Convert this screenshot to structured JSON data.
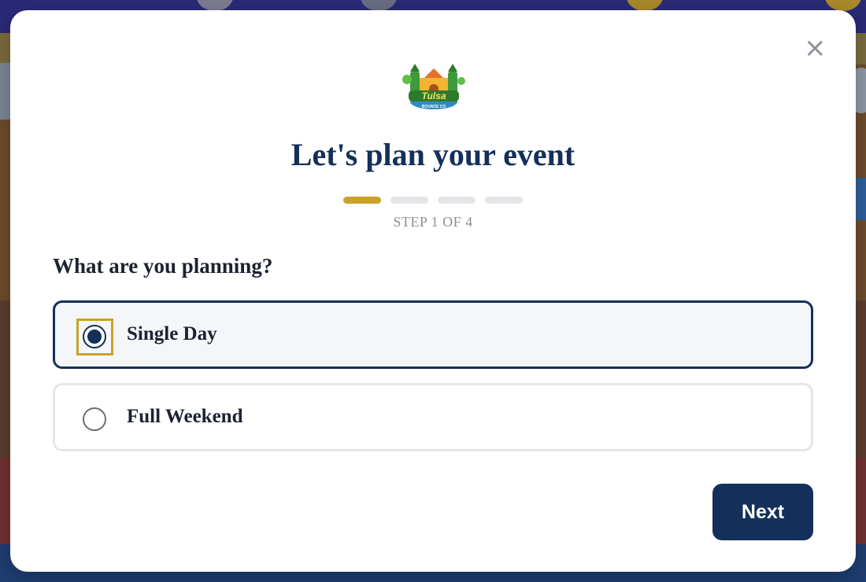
{
  "modal": {
    "title": "Let's plan your event",
    "step_label": "STEP 1 OF 4",
    "progress": {
      "current_step": 1,
      "total_steps": 4
    },
    "close_icon": "close-icon",
    "logo": {
      "text_main": "Tulsa",
      "text_sub": "BOUNCE CO"
    },
    "question": "What are you planning?",
    "options": [
      {
        "label": "Single Day",
        "selected": true
      },
      {
        "label": "Full Weekend",
        "selected": false
      }
    ],
    "next_label": "Next"
  },
  "colors": {
    "primary": "#14305a",
    "accent": "#c9a227",
    "muted": "#8b8f96",
    "track": "#e3e5e9"
  }
}
